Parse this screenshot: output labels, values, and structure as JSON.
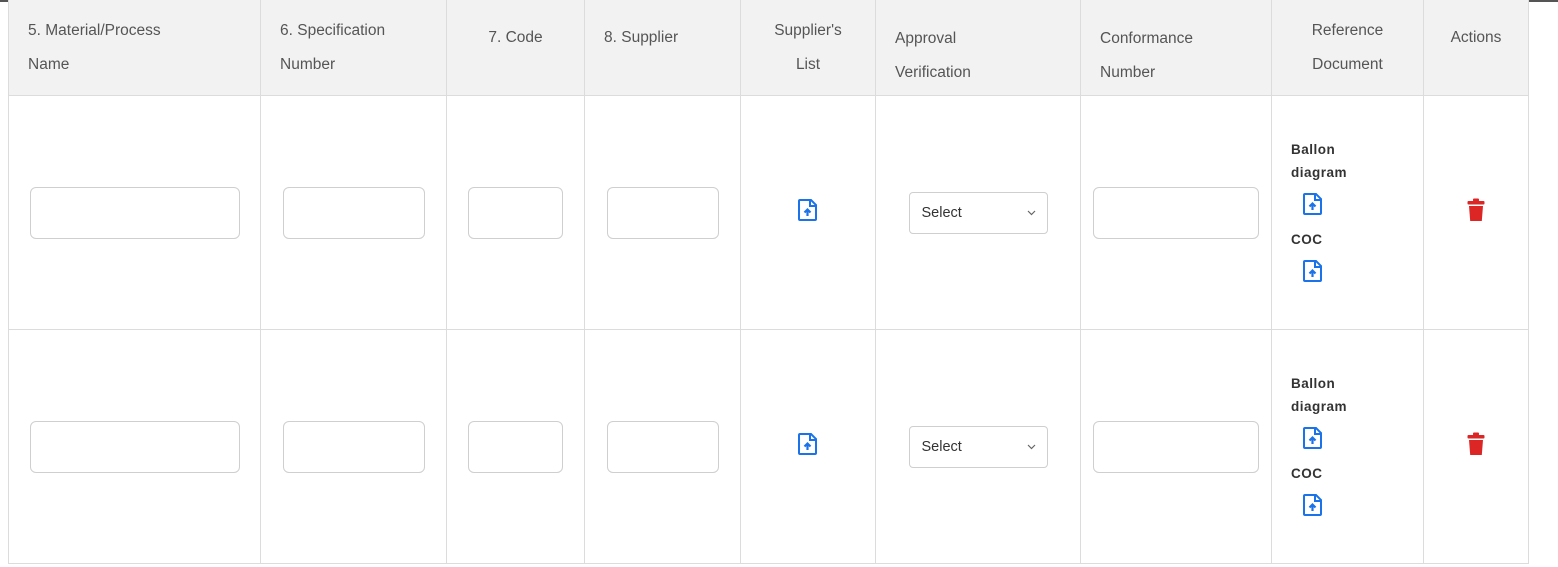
{
  "table": {
    "headers": [
      {
        "line1": "5. Material/Process",
        "line2": "Name"
      },
      {
        "line1": "6. Specification",
        "line2": "Number"
      },
      {
        "line1": "7. Code",
        "line2": ""
      },
      {
        "line1": "8. Supplier",
        "line2": ""
      },
      {
        "line1": "Supplier's",
        "line2": "List"
      },
      {
        "line1": "Approval",
        "line2": "Verification"
      },
      {
        "line1": "Conformance",
        "line2": "Number"
      },
      {
        "line1": "Reference",
        "line2": "Document"
      },
      {
        "line1": "Actions",
        "line2": ""
      }
    ],
    "rows": [
      {
        "material_name": "",
        "spec_number": "",
        "code": "",
        "supplier": "",
        "approval_select": "Select",
        "conformance_number": "",
        "ref_labels": [
          "Ballon diagram",
          "COC"
        ]
      },
      {
        "material_name": "",
        "spec_number": "",
        "code": "",
        "supplier": "",
        "approval_select": "Select",
        "conformance_number": "",
        "ref_labels": [
          "Ballon diagram",
          "COC"
        ]
      }
    ]
  },
  "icons": {
    "upload": "file-upload-icon",
    "delete": "trash-icon",
    "chevron": "chevron-down-icon"
  },
  "colors": {
    "accent_blue": "#1a73e8",
    "danger_red": "#dc2626",
    "header_bg": "#f2f2f2"
  }
}
